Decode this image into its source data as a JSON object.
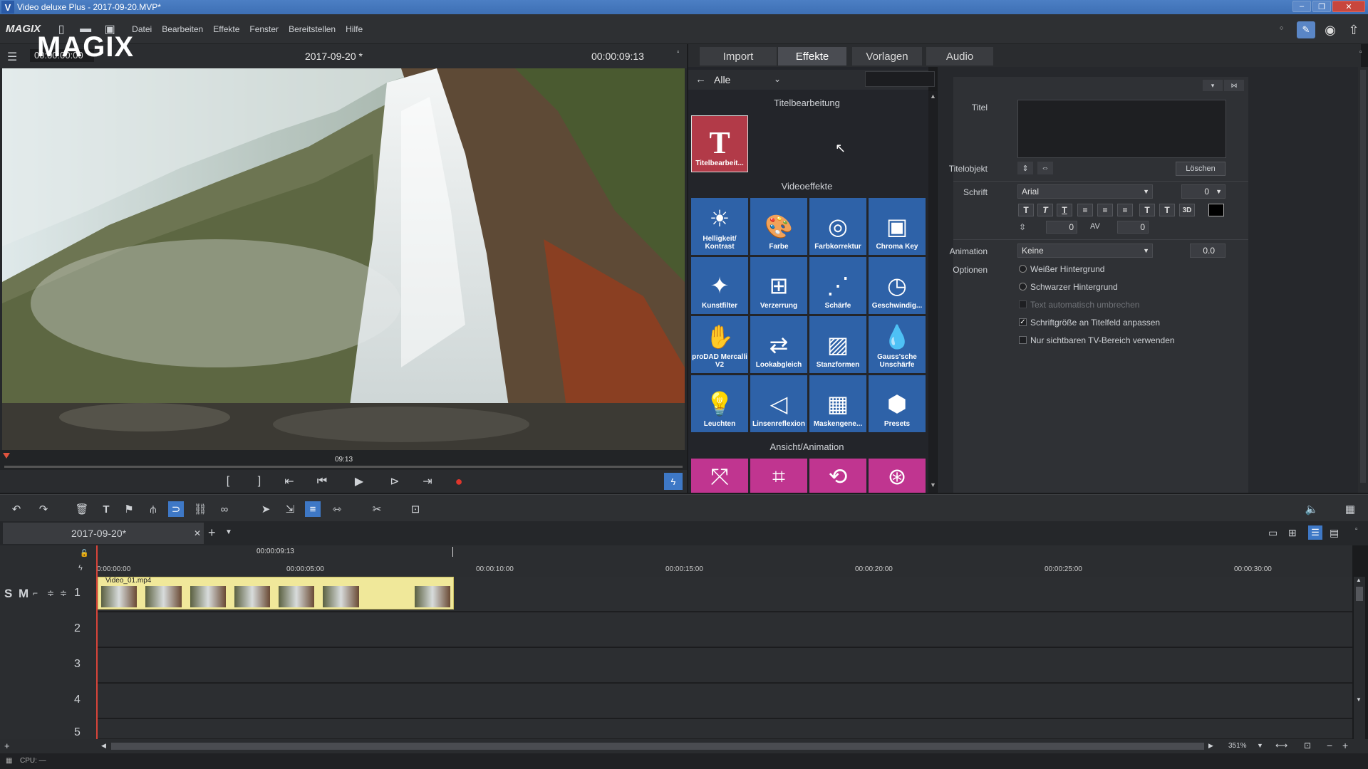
{
  "window": {
    "title": "Video deluxe Plus - 2017-09-20.MVP*",
    "app_icon": "V"
  },
  "menubar": {
    "brand": "MAGIX",
    "items": [
      "Datei",
      "Bearbeiten",
      "Effekte",
      "Fenster",
      "Bereitstellen",
      "Hilfe"
    ]
  },
  "preview": {
    "timecode_left": "00:00:00:00",
    "date": "2017-09-20 *",
    "timecode_right": "00:00:09:13",
    "watermark": "MAGIX",
    "scrub_label": "09:13"
  },
  "tabs": [
    {
      "label": "Import",
      "active": false
    },
    {
      "label": "Effekte",
      "active": true
    },
    {
      "label": "Vorlagen",
      "active": false
    },
    {
      "label": "Audio",
      "active": false
    }
  ],
  "effects": {
    "filter": "Alle",
    "sections": {
      "title_edit": "Titelbearbeitung",
      "video_effects": "Videoeffekte",
      "view_anim": "Ansicht/Animation"
    },
    "title_tile": "Titelbearbeit...",
    "tiles": [
      {
        "label": "Helligkeit/ Kontrast",
        "icon": "☀"
      },
      {
        "label": "Farbe",
        "icon": "🎨"
      },
      {
        "label": "Farbkorrektur",
        "icon": "◎"
      },
      {
        "label": "Chroma Key",
        "icon": "▣"
      },
      {
        "label": "Kunstfilter",
        "icon": "✦"
      },
      {
        "label": "Verzerrung",
        "icon": "⊞"
      },
      {
        "label": "Schärfe",
        "icon": "⋰"
      },
      {
        "label": "Geschwindig...",
        "icon": "◷"
      },
      {
        "label": "proDAD Mercalli V2",
        "icon": "✋"
      },
      {
        "label": "Lookabgleich",
        "icon": "⇄"
      },
      {
        "label": "Stanzformen",
        "icon": "▨"
      },
      {
        "label": "Gauss'sche Unschärfe",
        "icon": "💧"
      },
      {
        "label": "Leuchten",
        "icon": "💡"
      },
      {
        "label": "Linsenreflexion",
        "icon": "◁"
      },
      {
        "label": "Maskengene...",
        "icon": "▦"
      },
      {
        "label": "Presets",
        "icon": "⬢"
      }
    ],
    "anim_tiles": [
      "⤧",
      "⌗",
      "⟲",
      "⊛"
    ]
  },
  "settings": {
    "titel_label": "Titel",
    "titelobjekt_label": "Titelobjekt",
    "loeschen": "Löschen",
    "schrift_label": "Schrift",
    "font": "Arial",
    "font_size": "0",
    "spacing1": "0",
    "spacing2": "0",
    "animation_label": "Animation",
    "animation_value": "Keine",
    "animation_num": "0.0",
    "optionen_label": "Optionen",
    "options": [
      {
        "label": "Weißer Hintergrund",
        "type": "radio",
        "checked": false,
        "disabled": false
      },
      {
        "label": "Schwarzer Hintergrund",
        "type": "radio",
        "checked": false,
        "disabled": false
      },
      {
        "label": "Text automatisch umbrechen",
        "type": "check",
        "checked": false,
        "disabled": true
      },
      {
        "label": "Schriftgröße an Titelfeld anpassen",
        "type": "check",
        "checked": true,
        "disabled": false
      },
      {
        "label": "Nur sichtbaren TV-Bereich verwenden",
        "type": "check",
        "checked": false,
        "disabled": false
      }
    ]
  },
  "timeline": {
    "project_tab": "2017-09-20*",
    "ruler_marker": "00:00:09:13",
    "ruler_labels": [
      "0:00:00:00",
      "00:00:05:00",
      "00:00:10:00",
      "00:00:15:00",
      "00:00:20:00",
      "00:00:25:00",
      "00:00:30:00"
    ],
    "tracks": [
      "1",
      "2",
      "3",
      "4",
      "5"
    ],
    "clip_name": "Video_01.mp4",
    "solo": "S",
    "mute": "M",
    "zoom": "351%"
  },
  "status": {
    "cpu": "CPU: —"
  }
}
